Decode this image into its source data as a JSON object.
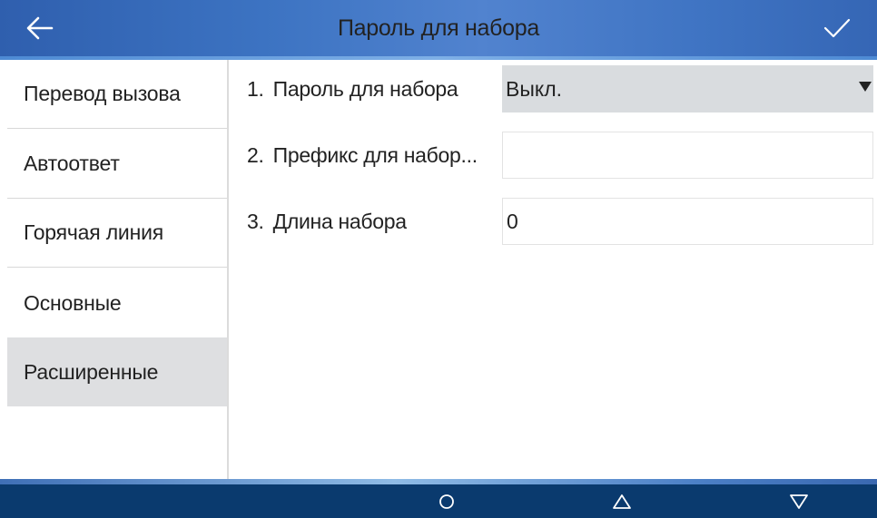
{
  "header": {
    "title": "Пароль для набора",
    "back_icon": "arrow-left-icon",
    "confirm_icon": "checkmark-icon"
  },
  "sidebar": {
    "items": [
      {
        "label": "Перевод вызова",
        "active": false
      },
      {
        "label": "Автоответ",
        "active": false
      },
      {
        "label": "Горячая линия",
        "active": false
      },
      {
        "label": "Основные",
        "active": false
      },
      {
        "label": "Расширенные",
        "active": true
      }
    ]
  },
  "settings": {
    "rows": [
      {
        "number": "1.",
        "label": "Пароль для набора",
        "type": "dropdown",
        "value": "Выкл."
      },
      {
        "number": "2.",
        "label": "Префикс для набор...",
        "type": "text",
        "value": ""
      },
      {
        "number": "3.",
        "label": "Длина набора",
        "type": "text",
        "value": "0"
      }
    ]
  },
  "navbar": {
    "buttons": [
      "home-circle-icon",
      "up-triangle-icon",
      "down-triangle-icon"
    ]
  },
  "colors": {
    "header": "#3c73c2",
    "footer": "#0a3a6e",
    "active_item": "#dedfe1",
    "dropdown_bg": "#d9dcdf"
  }
}
